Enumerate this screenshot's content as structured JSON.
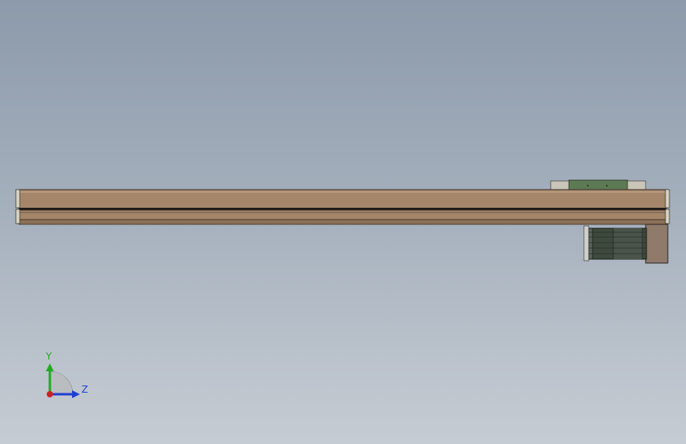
{
  "viewport": {
    "background_top": "#8c9aab",
    "background_bottom": "#c6ccd3"
  },
  "model": {
    "rail_color": "#a5866a",
    "rail_outline": "#3a2e25",
    "endcap_color": "#d8d4c4",
    "carriage_color": "#c9c5b8",
    "carriage_plate_color": "#5e7a55",
    "motor_color": "#3f4a3f",
    "motor_mount_color": "#8f7a6c"
  },
  "triad": {
    "y_label": "Y",
    "z_label": "Z",
    "y_color": "#22aa22",
    "z_color": "#1f3fd0",
    "x_color": "#d02020"
  }
}
